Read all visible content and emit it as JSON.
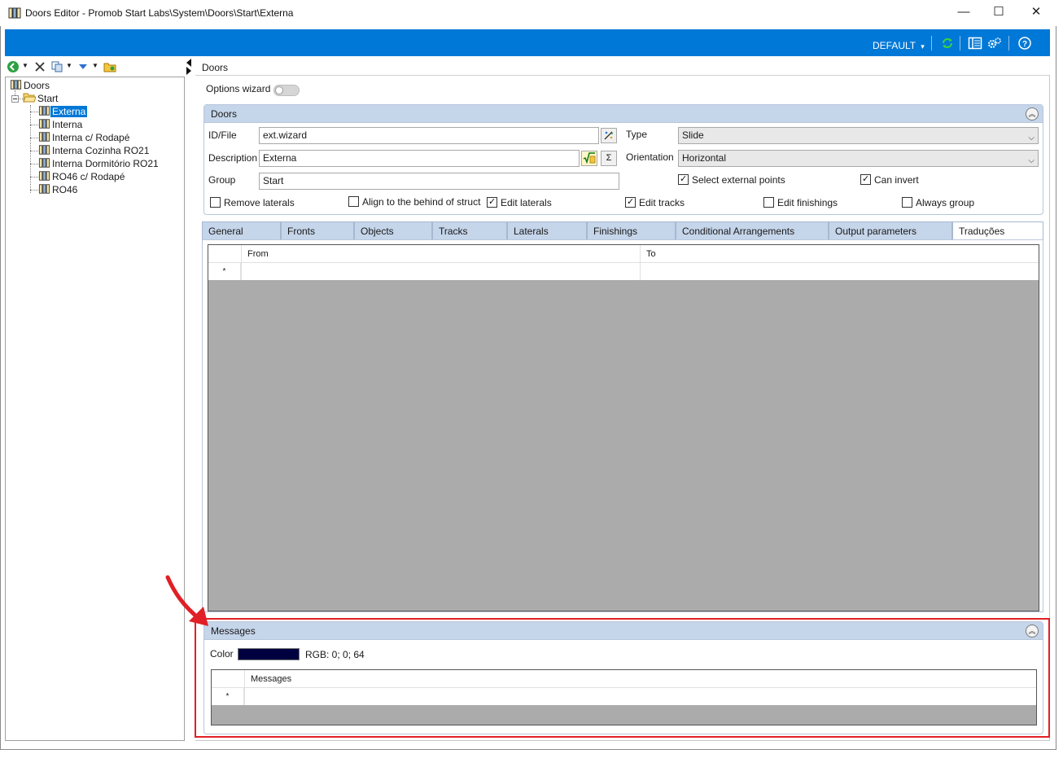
{
  "window": {
    "title": "Doors Editor - Promob Start Labs\\System\\Doors\\Start\\Externa",
    "minimize": "—",
    "maximize": "☐",
    "close": "✕"
  },
  "ribbon": {
    "profile_label": "DEFAULT",
    "profile_caret": "▾",
    "accent_color": "#0078d7"
  },
  "tree": {
    "root": "Doors",
    "folder": "Start",
    "items": [
      {
        "label": "Externa",
        "selected": true
      },
      {
        "label": "Interna"
      },
      {
        "label": "Interna c/ Rodapé"
      },
      {
        "label": "Interna Cozinha RO21"
      },
      {
        "label": "Interna Dormitório RO21"
      },
      {
        "label": "RO46 c/ Rodapé"
      },
      {
        "label": "RO46"
      }
    ]
  },
  "main": {
    "breadcrumb": "Doors",
    "options_wizard_label": "Options wizard",
    "options_wizard_enabled": false
  },
  "doors_group": {
    "title": "Doors",
    "id_file_label": "ID/File",
    "id_file_value": "ext.wizard",
    "description_label": "Description",
    "description_value": "Externa",
    "group_label": "Group",
    "group_value": "Start",
    "type_label": "Type",
    "type_value": "Slide",
    "orientation_label": "Orientation",
    "orientation_value": "Horizontal",
    "sigma_symbol": "Σ",
    "checkboxes": [
      {
        "label": "Select external points",
        "checked": true
      },
      {
        "label": "Can invert",
        "checked": true
      },
      {
        "label": "Remove laterals",
        "checked": false
      },
      {
        "label": "Align to the behind of struct",
        "checked": false
      },
      {
        "label": "Edit laterals",
        "checked": true
      },
      {
        "label": "Edit tracks",
        "checked": true
      },
      {
        "label": "Edit finishings",
        "checked": false
      },
      {
        "label": "Always group",
        "checked": false
      }
    ]
  },
  "tabs": [
    {
      "label": "General"
    },
    {
      "label": "Fronts"
    },
    {
      "label": "Objects"
    },
    {
      "label": "Tracks"
    },
    {
      "label": "Laterals"
    },
    {
      "label": "Finishings"
    },
    {
      "label": "Conditional Arrangements"
    },
    {
      "label": "Output parameters"
    },
    {
      "label": "Traduções",
      "active": true
    }
  ],
  "translations_grid": {
    "columns": [
      "From",
      "To"
    ],
    "new_row_marker": "*"
  },
  "messages_group": {
    "title": "Messages",
    "color_label": "Color",
    "color_value": "#000040",
    "rgb_text": "RGB: 0; 0; 64",
    "grid_column": "Messages",
    "new_row_marker": "*"
  },
  "annotation": {
    "highlight_color": "#e01f26"
  }
}
